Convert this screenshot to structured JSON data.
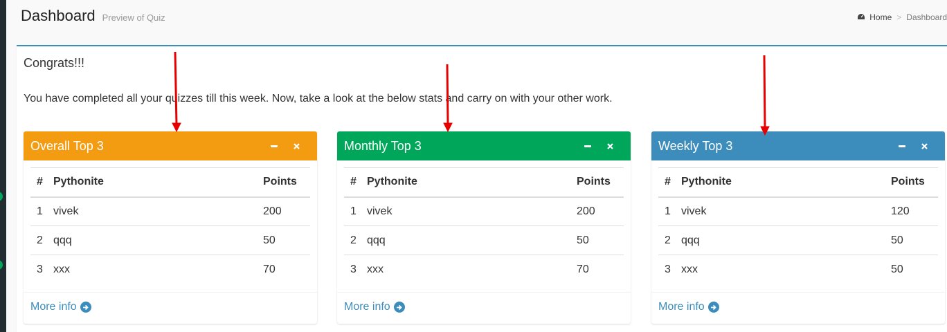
{
  "header": {
    "title": "Dashboard",
    "subtitle": "Preview of Quiz",
    "breadcrumb": {
      "home": "Home",
      "separator": ">",
      "current": "Dashboard"
    }
  },
  "main": {
    "heading": "Congrats!!!",
    "message": "You have completed all your quizzes till this week. Now, take a look at the below stats and carry on with your other work."
  },
  "panels": [
    {
      "title": "Overall Top 3",
      "color": "#f39c12",
      "columns": [
        "#",
        "Pythonite",
        "Points"
      ],
      "rows": [
        [
          "1",
          "vivek",
          "200"
        ],
        [
          "2",
          "qqq",
          "50"
        ],
        [
          "3",
          "xxx",
          "70"
        ]
      ],
      "footer_link": "More info"
    },
    {
      "title": "Monthly Top 3",
      "color": "#00a65a",
      "columns": [
        "#",
        "Pythonite",
        "Points"
      ],
      "rows": [
        [
          "1",
          "vivek",
          "200"
        ],
        [
          "2",
          "qqq",
          "50"
        ],
        [
          "3",
          "xxx",
          "70"
        ]
      ],
      "footer_link": "More info"
    },
    {
      "title": "Weekly Top 3",
      "color": "#3c8dbc",
      "columns": [
        "#",
        "Pythonite",
        "Points"
      ],
      "rows": [
        [
          "1",
          "vivek",
          "120"
        ],
        [
          "2",
          "qqq",
          "50"
        ],
        [
          "3",
          "xxx",
          "50"
        ]
      ],
      "footer_link": "More info"
    }
  ],
  "icons": {
    "collapse": "minus-icon",
    "remove": "times-icon",
    "more": "arrow-circle-right-icon",
    "breadcrumb": "dashboard-icon"
  },
  "colors": {
    "accent": "#3c8dbc",
    "annotation_arrow": "#e60000"
  }
}
